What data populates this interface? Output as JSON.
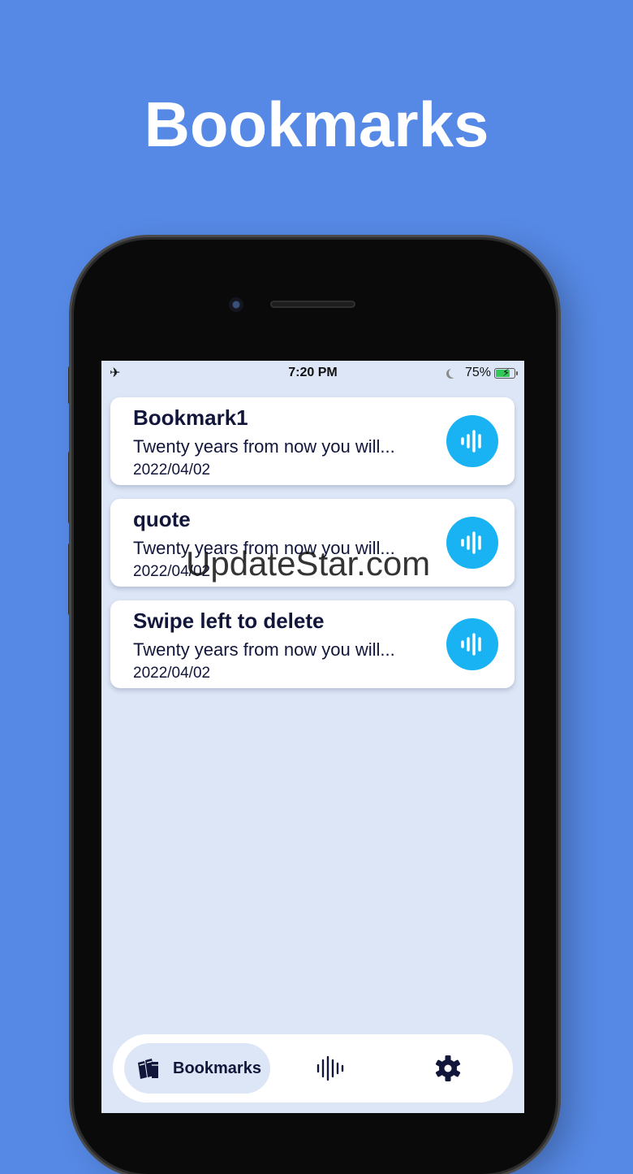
{
  "headline": "Bookmarks",
  "status_bar": {
    "time": "7:20 PM",
    "battery": "75%",
    "battery_level": 0.75,
    "icons": [
      "airplane-icon",
      "moon-icon",
      "battery-charging-icon"
    ]
  },
  "bookmarks": [
    {
      "title": "Bookmark1",
      "text": "Twenty years from now you will...",
      "date": "2022/04/02",
      "icon": "waveform-icon"
    },
    {
      "title": "quote",
      "text": "Twenty years from now you will...",
      "date": "2022/04/02",
      "icon": "waveform-icon"
    },
    {
      "title": "Swipe left to delete",
      "text": "Twenty years from now you will...",
      "date": "2022/04/02",
      "icon": "waveform-icon"
    }
  ],
  "watermark": "UpdateStar.com",
  "tabbar": {
    "bookmarks_label": "Bookmarks",
    "tabs": [
      "books-icon",
      "waveform-icon",
      "gear-icon"
    ]
  },
  "colors": {
    "background": "#5689e5",
    "screen": "#dde6f6",
    "accent": "#19b2f2",
    "text": "#11163a"
  }
}
